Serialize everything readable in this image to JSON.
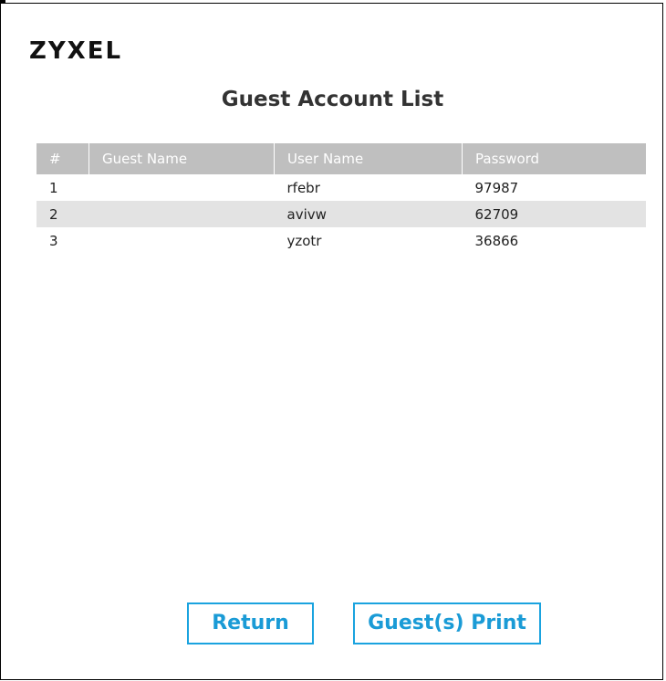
{
  "logo": {
    "text": "ZYXEL"
  },
  "page": {
    "title": "Guest Account List"
  },
  "table": {
    "headers": {
      "num": "#",
      "guest_name": "Guest Name",
      "user_name": "User Name",
      "password": "Password"
    },
    "rows": [
      {
        "num": "1",
        "guest_name": "",
        "user_name": "rfebr",
        "password": "97987"
      },
      {
        "num": "2",
        "guest_name": "",
        "user_name": "avivw",
        "password": "62709"
      },
      {
        "num": "3",
        "guest_name": "",
        "user_name": "yzotr",
        "password": "36866"
      }
    ]
  },
  "buttons": {
    "return_label": "Return",
    "print_label": "Guest(s) Print"
  },
  "colors": {
    "header_bg": "#bfbfbf",
    "alt_row_bg": "#e3e3e3",
    "button_accent": "#1aa3df"
  }
}
